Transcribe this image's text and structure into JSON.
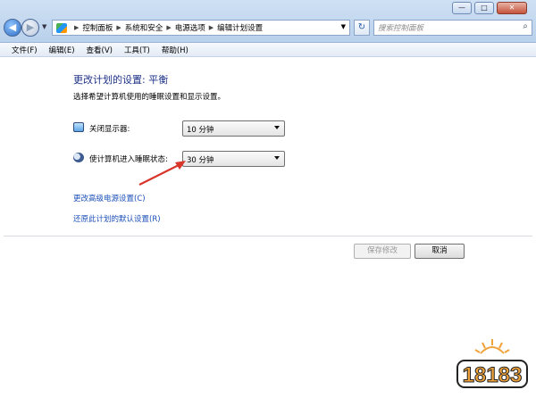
{
  "window": {
    "minimize": "—",
    "maximize": "□",
    "close": "✕"
  },
  "address_bar": {
    "breadcrumbs": [
      "控制面板",
      "系统和安全",
      "电源选项",
      "编辑计划设置"
    ]
  },
  "search": {
    "placeholder": "搜索控制面板"
  },
  "menu": {
    "items": [
      "文件(F)",
      "编辑(E)",
      "查看(V)",
      "工具(T)",
      "帮助(H)"
    ]
  },
  "page": {
    "title": "更改计划的设置: 平衡",
    "subtitle": "选择希望计算机使用的睡眠设置和显示设置。"
  },
  "settings": {
    "display_off": {
      "label": "关闭显示器:",
      "value": "10 分钟"
    },
    "sleep": {
      "label": "使计算机进入睡眠状态:",
      "value": "30 分钟"
    }
  },
  "links": {
    "advanced": "更改高级电源设置(C)",
    "restore": "还原此计划的默认设置(R)"
  },
  "buttons": {
    "save": "保存修改",
    "cancel": "取消"
  },
  "watermark": {
    "text": "18183"
  },
  "colors": {
    "title": "#1e3287",
    "link": "#1b50b8",
    "annotation_arrow": "#d9362b"
  },
  "icons": {
    "display": "monitor-icon",
    "sleep": "sleep-moon-icon",
    "back": "back-arrow-icon",
    "forward": "forward-arrow-icon",
    "refresh": "refresh-icon",
    "search": "search-icon"
  }
}
